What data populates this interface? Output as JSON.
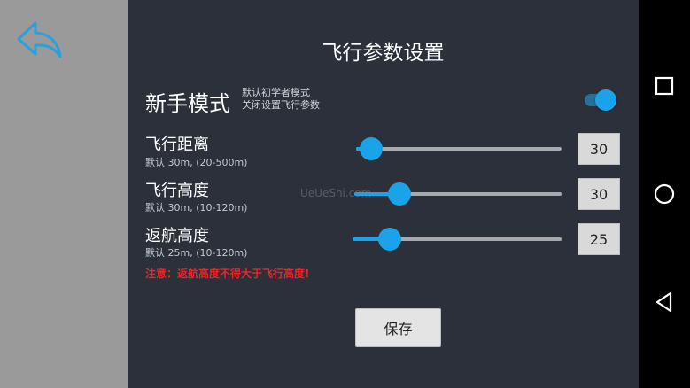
{
  "header": {
    "title": "飞行参数设置"
  },
  "novice": {
    "label": "新手模式",
    "desc_line1": "默认初学者模式",
    "desc_line2": "关闭设置飞行参数",
    "enabled": true
  },
  "settings": [
    {
      "label": "飞行距离",
      "hint": "默认 30m, (20-500m)",
      "value": "30",
      "min": 20,
      "max": 500,
      "current": 30
    },
    {
      "label": "飞行高度",
      "hint": "默认 30m, (10-120m)",
      "value": "30",
      "min": 10,
      "max": 120,
      "current": 30
    },
    {
      "label": "返航高度",
      "hint": "默认 25m, (10-120m)",
      "value": "25",
      "min": 10,
      "max": 120,
      "current": 25
    }
  ],
  "warning": "注意：返航高度不得大于飞行高度!",
  "save_label": "保存",
  "watermark": "UeUeShi.com",
  "colors": {
    "accent": "#1aa3e8",
    "panel": "#2b303a",
    "warning": "#e8262b"
  },
  "icons": {
    "back": "back-arrow-icon",
    "recent": "square-icon",
    "home": "circle-icon",
    "nav_back": "triangle-back-icon"
  }
}
